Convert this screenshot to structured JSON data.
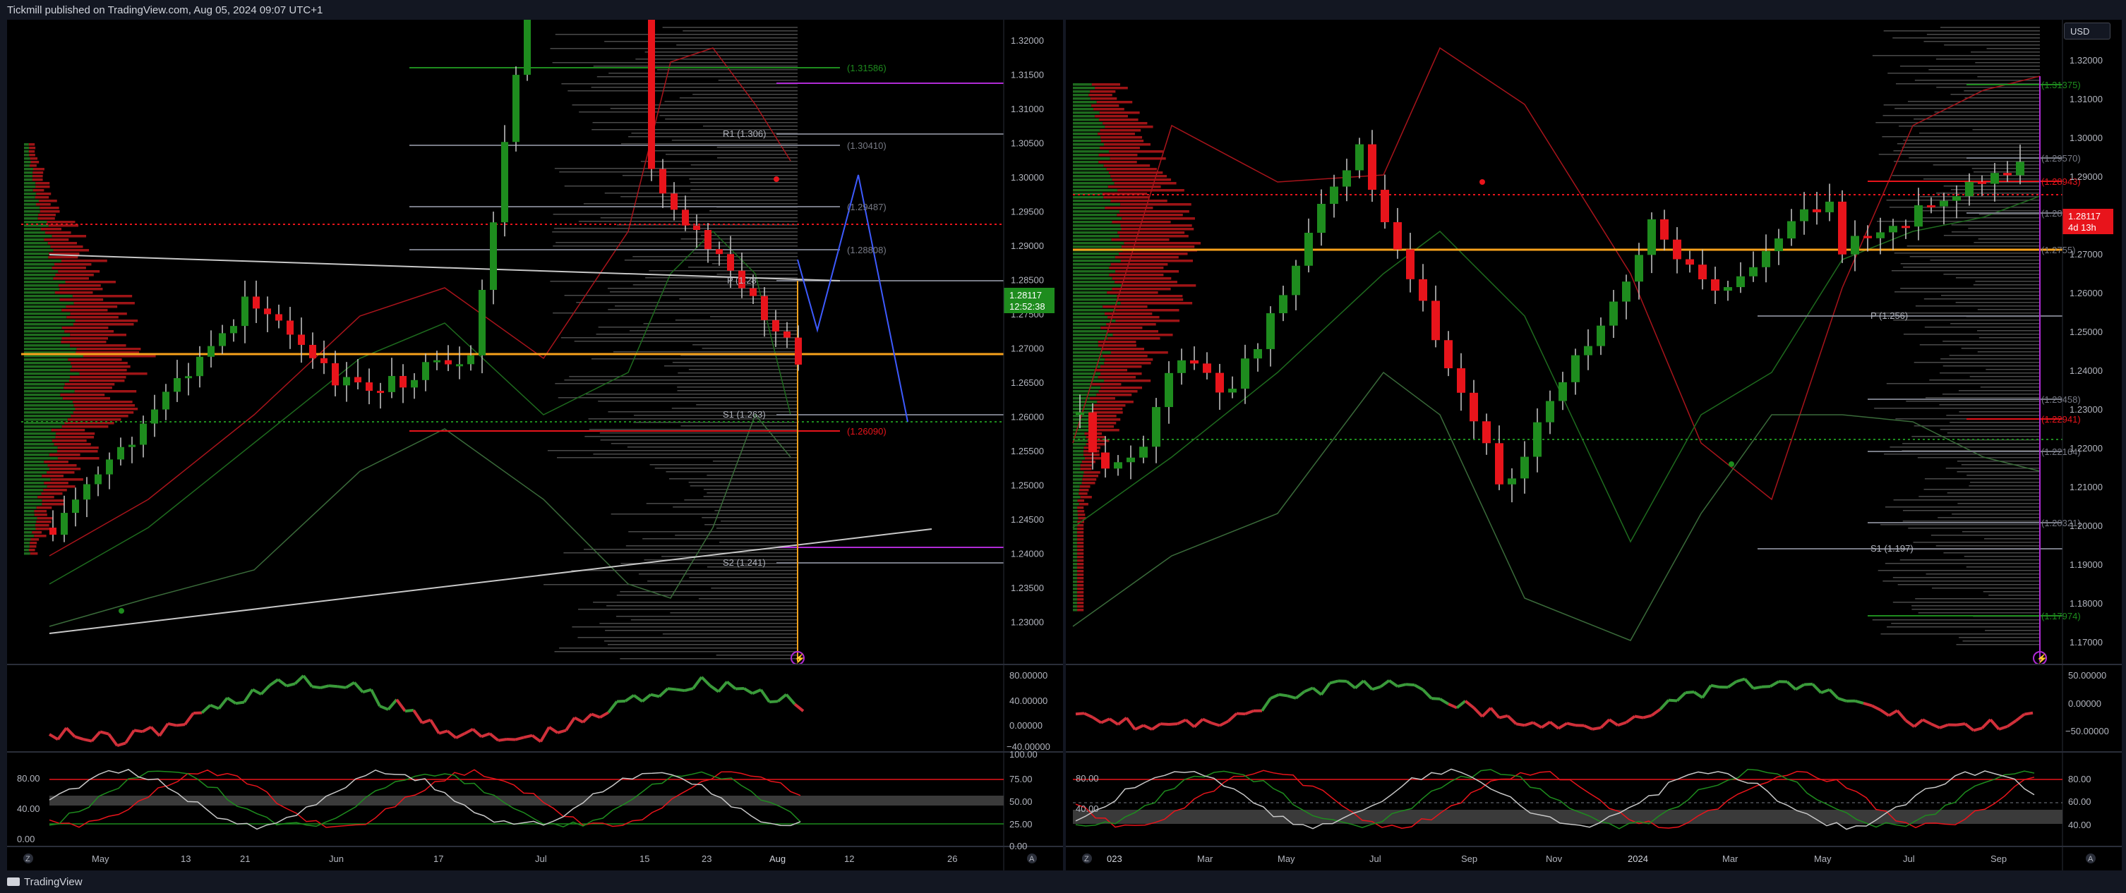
{
  "header": {
    "publish_info": "Tickmill published on TradingView.com, Aug 05, 2024 09:07 UTC+1"
  },
  "footer": {
    "brand": "TradingView"
  },
  "colors": {
    "bull": "#1e8c1e",
    "bear": "#e8141b",
    "poc": "#f7a21b",
    "price_badge_left": "#1e8c1e",
    "price_badge_right": "#e8141b",
    "bg": "#000000"
  },
  "left_chart": {
    "price_axis": [
      "1.32000",
      "1.31500",
      "1.31000",
      "1.30500",
      "1.30000",
      "1.29500",
      "1.29000",
      "1.28500",
      "1.27500",
      "1.27000",
      "1.26500",
      "1.26000",
      "1.25500",
      "1.25000",
      "1.24500",
      "1.24000",
      "1.23500",
      "1.23000"
    ],
    "current_price": "1.28117",
    "countdown": "12:52:38",
    "levels": {
      "r1": "R1 (1.306)",
      "p": "P (1.28",
      "s1": "S1 (1.263)",
      "s2": "S2 (1.241)"
    },
    "fib_labels": [
      "(1.31586)",
      "(1.30410)",
      "(1.29487)",
      "(1.28808)",
      "(1.26090)"
    ],
    "time_axis": [
      "May",
      "13",
      "21",
      "Jun",
      "17",
      "Jul",
      "15",
      "23",
      "Aug",
      "12",
      "26"
    ],
    "osc1_axis": [
      "80.00000",
      "40.00000",
      "0.00000",
      "−40.00000"
    ],
    "osc2_axis_left": [
      "80.00",
      "40.00",
      "0.00"
    ],
    "osc2_axis_right": [
      "100.00",
      "75.00",
      "50.00",
      "25.00",
      "0.00"
    ],
    "icons": {
      "zoom": "Z",
      "auto": "A"
    }
  },
  "right_chart": {
    "currency_button": "USD",
    "price_axis": [
      "1.32000",
      "1.31000",
      "1.30000",
      "1.29000",
      "1.28000",
      "1.27000",
      "1.26000",
      "1.25000",
      "1.24000",
      "1.23000",
      "1.22000",
      "1.21000",
      "1.20000",
      "1.19000",
      "1.18000",
      "1.17000"
    ],
    "current_price": "1.28117",
    "countdown": "4d 13h",
    "levels": {
      "p": "P (1.256)",
      "s1": "S1 (1.197)"
    },
    "fib_labels": [
      "(1.31375)",
      "(1.29570)",
      "(1.28943)",
      "(1.28153)",
      "(1.2755)",
      "(1.23458)",
      "(1.22941)",
      "(1.22164)",
      "(1.20321)",
      "(1.17974)"
    ],
    "time_axis": [
      "023",
      "Mar",
      "May",
      "Jul",
      "Sep",
      "Nov",
      "2024",
      "Mar",
      "May",
      "Jul",
      "Sep"
    ],
    "osc1_axis": [
      "50.00000",
      "0.00000",
      "−50.00000"
    ],
    "osc2_axis_left": [
      "80.00",
      "40.00"
    ],
    "osc2_axis_right": [
      "80.00",
      "60.00",
      "40.00"
    ],
    "icons": {
      "zoom": "Z",
      "auto": "A"
    }
  }
}
